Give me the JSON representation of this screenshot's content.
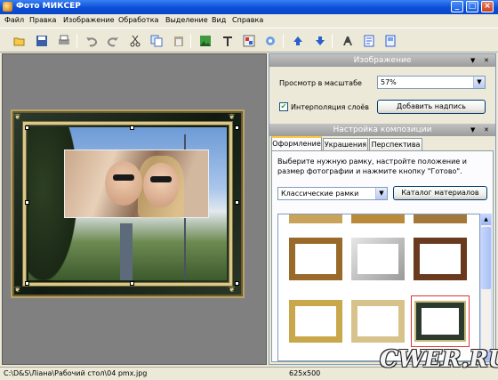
{
  "window": {
    "title": "Фото МИКСЕР",
    "controls": [
      "_",
      "□",
      "×"
    ]
  },
  "menu": [
    "Файл",
    "Правка",
    "Изображение",
    "Обработка",
    "Выделение",
    "Вид",
    "Справка"
  ],
  "toolbar": {
    "icons": [
      "open-icon",
      "save-icon",
      "print-icon",
      "undo-icon",
      "redo-icon",
      "cut-icon",
      "copy-icon",
      "paste-icon",
      "image-icon",
      "text-icon",
      "layers-icon",
      "effects-icon",
      "move-up-icon",
      "move-down-icon",
      "font-icon",
      "document-icon",
      "page-icon"
    ]
  },
  "image_panel": {
    "header": "Изображение",
    "zoom_label": "Просмотр в масштабе",
    "zoom_value": "57%",
    "interpolation_label": "Интерполяция слоёв",
    "interpolation_checked": true,
    "add_caption_button": "Добавить надпись"
  },
  "composition_panel": {
    "header": "Настройка композиции",
    "tabs": [
      "Оформление",
      "Украшения",
      "Перспектива"
    ],
    "active_tab": "Оформление",
    "instruction": "Выберите нужную рамку, настройте положение и размер фотографии и нажмите кнопку \"Готово\".",
    "frame_category": "Классические рамки",
    "catalog_button": "Каталог материалов"
  },
  "status": {
    "path": "C:\\D&S\\Лiана\\Рабочий стол\\04 pmx.jpg",
    "dimensions": "625x500"
  },
  "watermark": "CWER.RU"
}
